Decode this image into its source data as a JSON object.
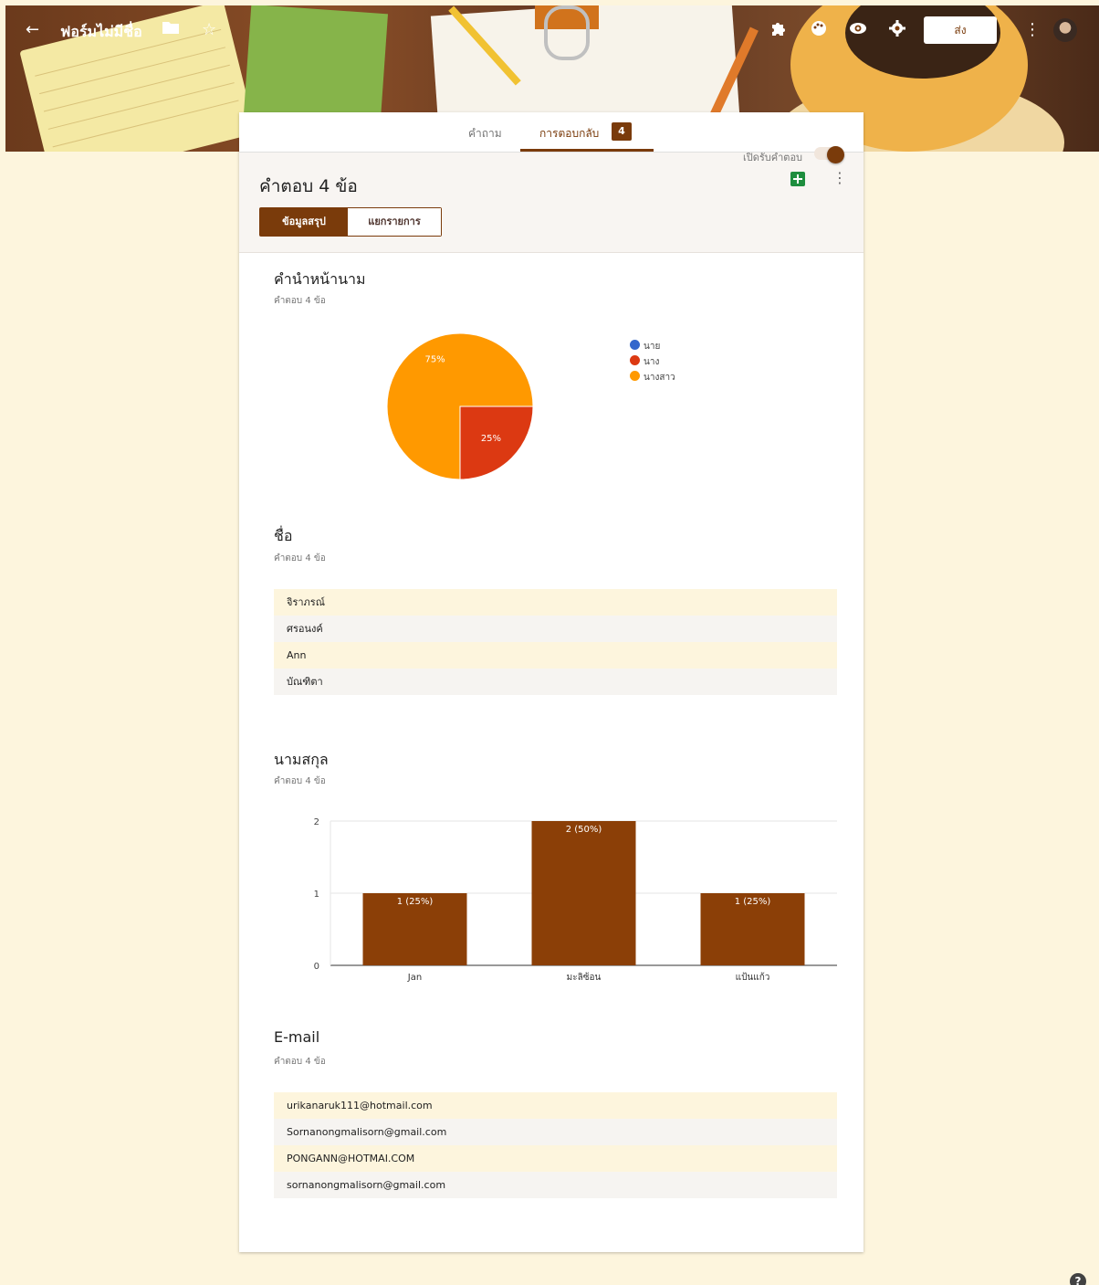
{
  "header": {
    "form_title": "ฟอร์มไม่มีชื่อ",
    "send_label": "ส่ง",
    "icons": [
      "back-icon",
      "folder-icon",
      "star-icon",
      "addon-icon",
      "palette-icon",
      "preview-icon",
      "settings-icon",
      "more-icon"
    ]
  },
  "tabs": {
    "questions": "คำถาม",
    "responses": "การตอบกลับ",
    "response_count": "4"
  },
  "summary": {
    "title": "คำตอบ 4 ข้อ",
    "summary_label": "ข้อมูลสรุป",
    "individual_label": "แยกรายการ",
    "accepting_label": "เปิดรับคำตอบ",
    "accepting": true
  },
  "colors": {
    "accent": "#7a3b0b",
    "background": "#fdf5dd",
    "pie_blue": "#3366cc",
    "pie_red": "#dc3912",
    "pie_orange": "#ff9900"
  },
  "questions": [
    {
      "title": "คำนำหน้านาม",
      "count_label": "คำตอบ 4 ข้อ"
    },
    {
      "title": "ชื่อ",
      "count_label": "คำตอบ 4 ข้อ",
      "answers": [
        "จิราภรณ์",
        "ศรอนงค์",
        "Ann",
        "บัณฑิตา"
      ]
    },
    {
      "title": "นามสกุล",
      "count_label": "คำตอบ 4 ข้อ"
    },
    {
      "title": "E-mail",
      "count_label": "คำตอบ 4 ข้อ",
      "answers": [
        "urikanaruk111@hotmail.com",
        "Sornanongmalisorn@gmail.com",
        "PONGANN@HOTMAI.COM",
        "sornanongmalisorn@gmail.com"
      ]
    }
  ],
  "chart_data": [
    {
      "type": "pie",
      "series": [
        {
          "label": "นาย",
          "value": 0,
          "color": "#3366cc"
        },
        {
          "label": "นาง",
          "value": 25,
          "color": "#dc3912"
        },
        {
          "label": "นางสาว",
          "value": 75,
          "color": "#ff9900"
        }
      ],
      "slice_labels": [
        "75%",
        "25%"
      ],
      "legend_position": "right"
    },
    {
      "type": "bar",
      "categories": [
        "Jan",
        "มะลิซ้อน",
        "แป้นแก้ว"
      ],
      "values": [
        1,
        2,
        1
      ],
      "data_labels": [
        "1 (25%)",
        "2 (50%)",
        "1 (25%)"
      ],
      "ylim": [
        0,
        2
      ],
      "yticks": [
        "0",
        "1",
        "2"
      ],
      "color": "#8b3f07",
      "grid": true
    }
  ]
}
